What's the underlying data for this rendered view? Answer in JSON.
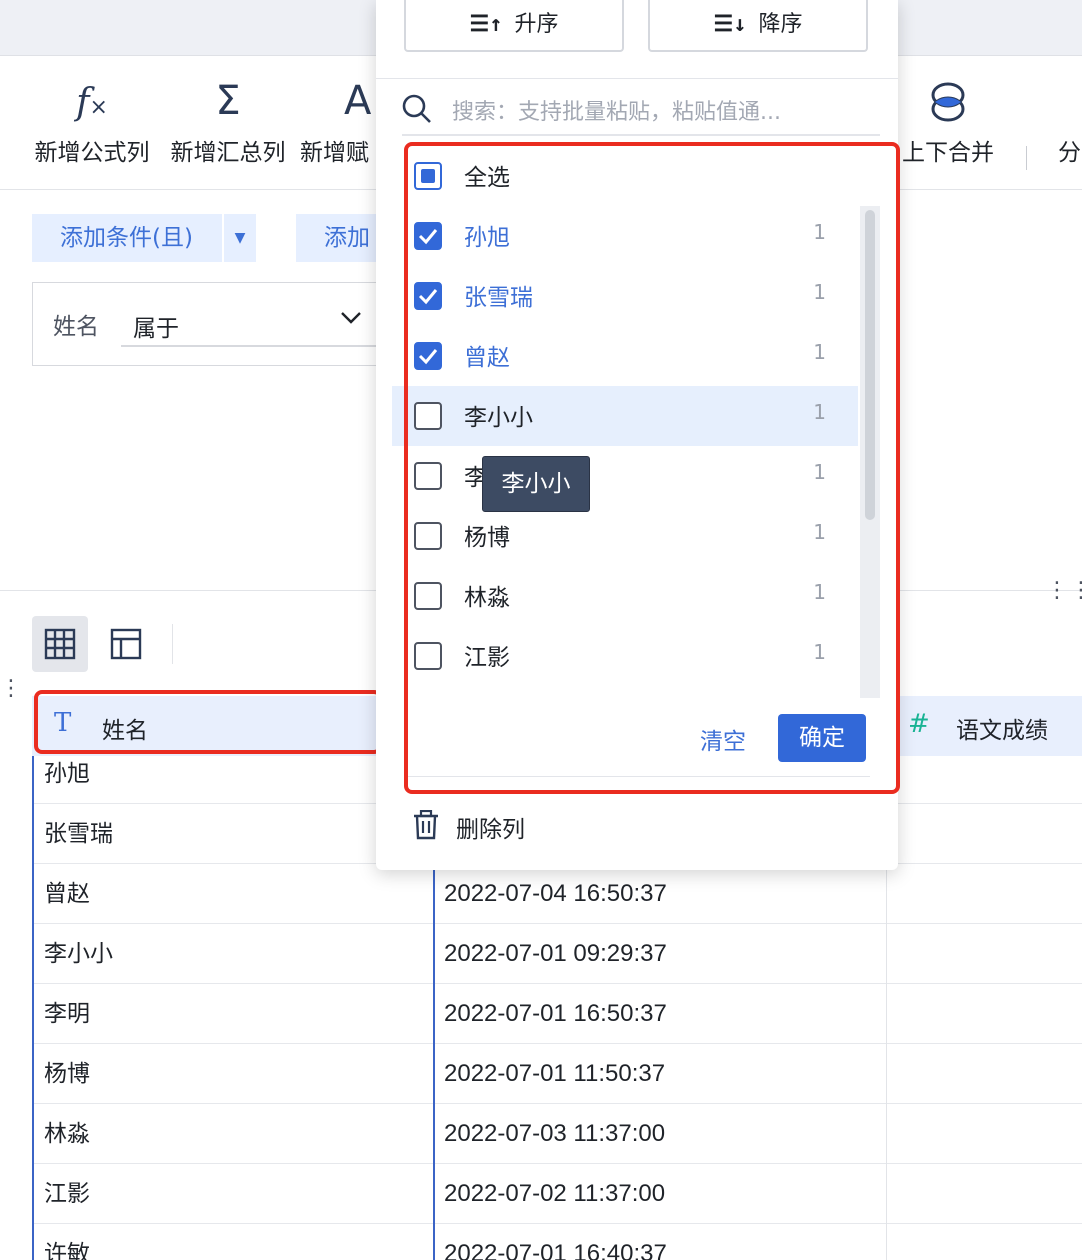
{
  "toolbar": {
    "items": [
      {
        "label": "新增公式列",
        "icon": "fx-icon"
      },
      {
        "label": "新增汇总列",
        "icon": "sigma-icon"
      },
      {
        "label": "新增赋",
        "icon": "text-assign-icon"
      },
      {
        "label": "上下合并",
        "icon": "merge-icon"
      },
      {
        "label": "分",
        "icon": ""
      }
    ]
  },
  "filter": {
    "add_and_label": "添加条件(且)",
    "add_or_label": "添加",
    "field": "姓名",
    "operator": "属于"
  },
  "table": {
    "columns": [
      "姓名",
      "语文成绩"
    ],
    "rows": [
      {
        "name": "孙旭",
        "time": ""
      },
      {
        "name": "张雪瑞",
        "time": ""
      },
      {
        "name": "曾赵",
        "time": "2022-07-04 16:50:37"
      },
      {
        "name": "李小小",
        "time": "2022-07-01 09:29:37"
      },
      {
        "name": "李明",
        "time": "2022-07-01 16:50:37"
      },
      {
        "name": "杨博",
        "time": "2022-07-01 11:50:37"
      },
      {
        "name": "林淼",
        "time": "2022-07-03 11:37:00"
      },
      {
        "name": "江影",
        "time": "2022-07-02 11:37:00"
      },
      {
        "name": "许敏",
        "time": "2022-07-01 16:40:37"
      }
    ]
  },
  "popup": {
    "sort_asc": "升序",
    "sort_desc": "降序",
    "search_placeholder": "搜索：支持批量粘贴，粘贴值通...",
    "select_all": "全选",
    "items": [
      {
        "name": "孙旭",
        "count": "1",
        "checked": true
      },
      {
        "name": "张雪瑞",
        "count": "1",
        "checked": true
      },
      {
        "name": "曾赵",
        "count": "1",
        "checked": true
      },
      {
        "name": "李小小",
        "count": "1",
        "checked": false
      },
      {
        "name": "李",
        "count": "1",
        "checked": false
      },
      {
        "name": "杨博",
        "count": "1",
        "checked": false
      },
      {
        "name": "林淼",
        "count": "1",
        "checked": false
      },
      {
        "name": "江影",
        "count": "1",
        "checked": false
      }
    ],
    "tooltip": "李小小",
    "clear_label": "清空",
    "confirm_label": "确定",
    "delete_label": "删除列"
  },
  "colors": {
    "accent": "#3268d8",
    "highlight": "#ea2c20",
    "header_bg": "#e8effd"
  }
}
